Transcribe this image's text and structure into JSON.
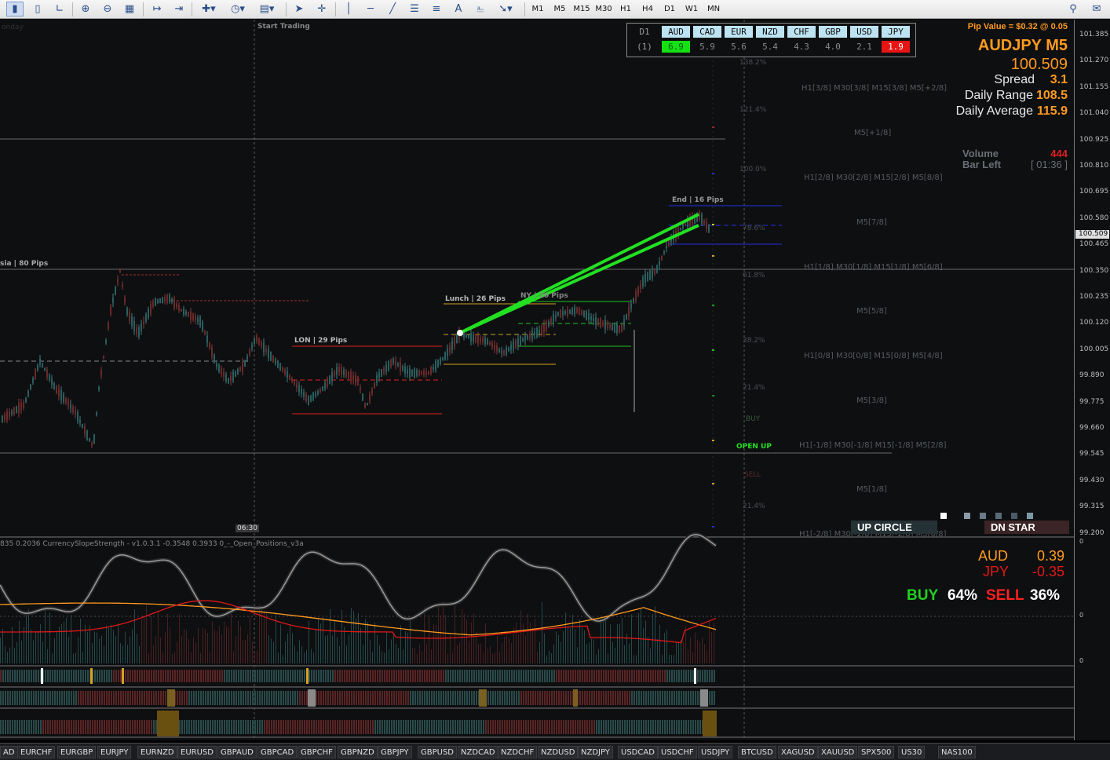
{
  "toolbar": {
    "timeframes": [
      "M1",
      "M5",
      "M15",
      "M30",
      "H1",
      "H4",
      "D1",
      "W1",
      "MN"
    ]
  },
  "chart": {
    "symbol_title": "AUDJPY M5",
    "bid": "100.509",
    "pip_value": "Pip Value = $0.32 @ 0.05",
    "spread_label": "Spread",
    "spread": "3.1",
    "daily_range_label": "Daily Range",
    "daily_range": "108.5",
    "daily_avg_label": "Daily Average",
    "daily_avg": "115.9",
    "volume_label": "Volume",
    "volume": "444",
    "bar_left_label": "Bar Left",
    "bar_left": "[ 01:36 ]",
    "corner_label": "onday",
    "start_trading": "Start Trading",
    "time_label": "06:30",
    "sessions": {
      "asia": "sia | 80 Pips",
      "london": "LON | 29 Pips",
      "lunch": "Lunch | 26 Pips",
      "ny": "NY | 20 Pips",
      "end": "End | 16 Pips"
    },
    "signals": {
      "open_up": "OPEN UP",
      "buy": "BUY",
      "sell": "SELL"
    },
    "fib_levels": [
      "138.2%",
      "121.4%",
      "100.0%",
      "78.6%",
      "61.8%",
      "38.2%",
      "21.4%",
      "21.4%"
    ],
    "murrey": [
      "H1[3/8] M30[3/8] M15[3/8] M5[+2/8]",
      "M5[+1/8]",
      "H1[2/8] M30[2/8] M15[2/8] M5[8/8]",
      "M5[7/8]",
      "H1[1/8] M30[1/8] M15[1/8] M5[6/8]",
      "M5[5/8]",
      "H1[0/8] M30[0/8] M15[0/8] M5[4/8]",
      "M5[3/8]",
      "H1[-1/8] M30[-1/8] M15[-1/8] M5[2/8]",
      "M5[1/8]",
      "H1[-2/8] M30[-2/8] M15[-2/8] M5[0/8]"
    ],
    "price_ticks": [
      "101.385",
      "101.270",
      "101.155",
      "101.040",
      "100.925",
      "100.810",
      "100.695",
      "100.580",
      "100.465",
      "100.350",
      "100.235",
      "100.120",
      "100.005",
      "99.890",
      "99.775",
      "99.660",
      "99.545",
      "99.430",
      "99.315",
      "99.200"
    ],
    "badges": {
      "up_circle": "UP CIRCLE",
      "dn_star": "DN STAR"
    }
  },
  "strength": {
    "row1_label": "D1",
    "row2_label": "(1)",
    "currencies": [
      "AUD",
      "CAD",
      "EUR",
      "NZD",
      "CHF",
      "GBP",
      "USD",
      "JPY"
    ],
    "values": [
      "6.9",
      "5.9",
      "5.6",
      "5.4",
      "4.3",
      "4.0",
      "2.1",
      "1.9"
    ]
  },
  "indicator": {
    "caption": "835 0.2036  CurrencySlopeStrength - v1.0.3.1 -0.3548 0.3933  0_-_Open_Positions_v3a",
    "base_label": "AUD",
    "base_value": "0.39",
    "quote_label": "JPY",
    "quote_value": "-0.35",
    "buy_label": "BUY",
    "buy_pct": "64%",
    "sell_label": "SELL",
    "sell_pct": "36%",
    "axis_top": "0",
    "axis_mid": "0",
    "axis_bottom": "0"
  },
  "symbols": [
    "AD",
    "EURCHF",
    "EURGBP",
    "EURJPY",
    "EURNZD",
    "EURUSD",
    "GBPAUD",
    "GBPCAD",
    "GBPCHF",
    "GBPNZD",
    "GBPJPY",
    "GBPUSD",
    "NZDCAD",
    "NZDCHF",
    "NZDUSD",
    "NZDJPY",
    "USDCAD",
    "USDCHF",
    "USDJPY",
    "BTCUSD",
    "XAGUSD",
    "XAUUSD",
    "SPX500",
    "US30",
    "NAS100"
  ],
  "colors": {
    "accent_orange": "#ff9a1e",
    "green": "#22e022",
    "red": "#ff2020"
  }
}
